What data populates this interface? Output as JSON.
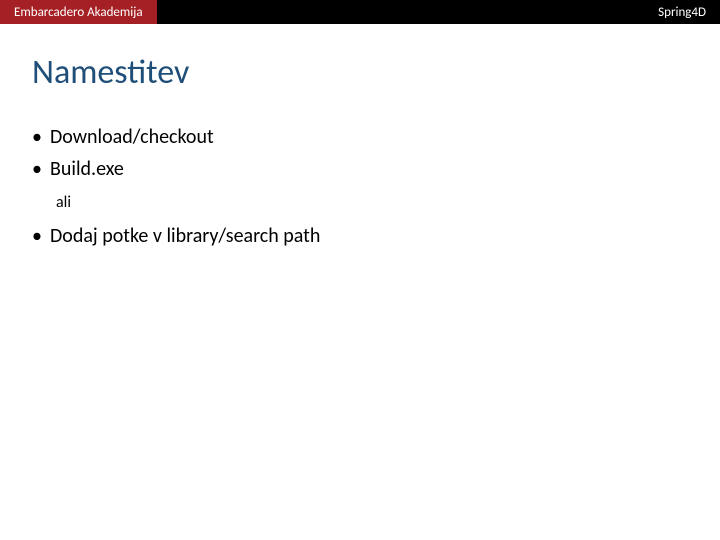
{
  "header": {
    "left_label": "Embarcadero Akademija",
    "right_label": "Spring4D"
  },
  "slide": {
    "title": "Namestitev",
    "bullets_group1": [
      "Download/checkout",
      "Build.exe"
    ],
    "separator_text": "ali",
    "bullets_group2": [
      "Dodaj potke v library/search path"
    ]
  }
}
